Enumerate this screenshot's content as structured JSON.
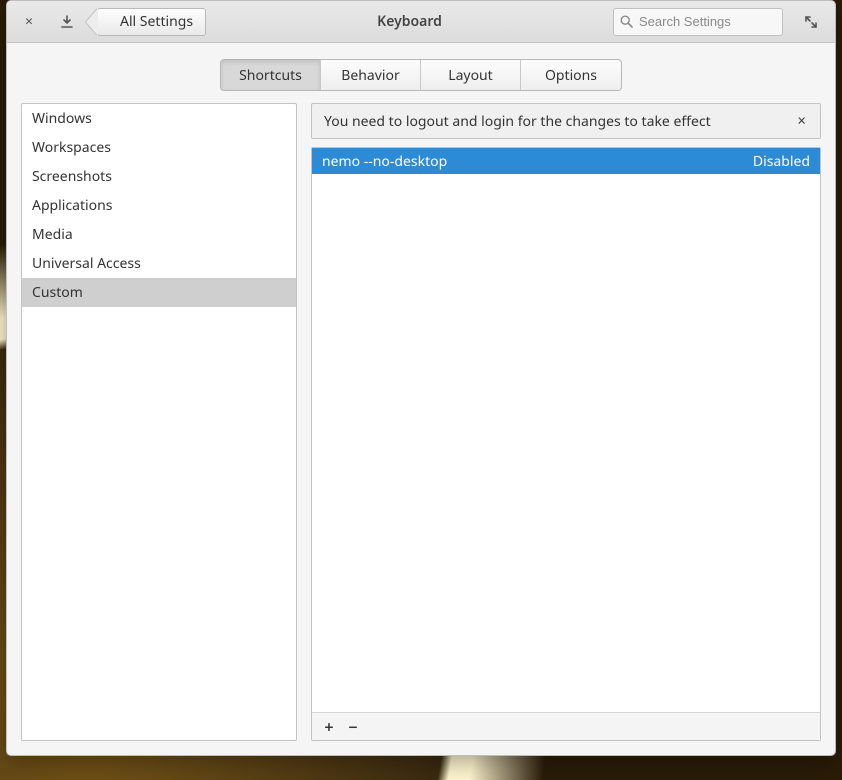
{
  "header": {
    "title": "Keyboard",
    "back_label": "All Settings",
    "search_placeholder": "Search Settings"
  },
  "tabs": [
    {
      "label": "Shortcuts",
      "active": true
    },
    {
      "label": "Behavior",
      "active": false
    },
    {
      "label": "Layout",
      "active": false
    },
    {
      "label": "Options",
      "active": false
    }
  ],
  "sidebar": {
    "categories": [
      {
        "label": "Windows",
        "selected": false
      },
      {
        "label": "Workspaces",
        "selected": false
      },
      {
        "label": "Screenshots",
        "selected": false
      },
      {
        "label": "Applications",
        "selected": false
      },
      {
        "label": "Media",
        "selected": false
      },
      {
        "label": "Universal Access",
        "selected": false
      },
      {
        "label": "Custom",
        "selected": true
      }
    ]
  },
  "notice": {
    "text": "You need to logout and login for the changes to take effect"
  },
  "shortcuts": {
    "rows": [
      {
        "command": "nemo --no-desktop",
        "binding": "Disabled",
        "selected": true
      }
    ]
  },
  "toolbar": {
    "add_label": "+",
    "remove_label": "−"
  },
  "icons": {
    "close_glyph": "×",
    "dismiss_glyph": "×"
  }
}
